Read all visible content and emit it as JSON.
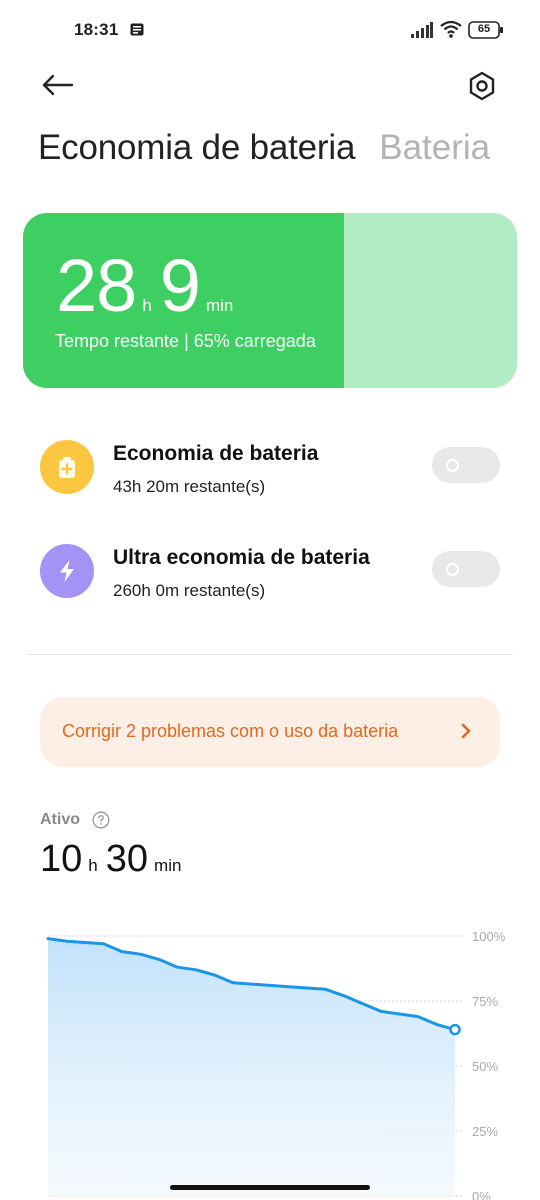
{
  "status_bar": {
    "time": "18:31",
    "battery_level": "65",
    "icons": [
      "notification-icon",
      "signal-icon",
      "wifi-icon",
      "battery-icon"
    ]
  },
  "header": {
    "icons": [
      "back-arrow-icon",
      "settings-hexagon-icon"
    ]
  },
  "tabs": {
    "active": "Economia de bateria",
    "inactive": "Bateria"
  },
  "battery_card": {
    "hours": "28",
    "hours_unit": "h",
    "minutes": "9",
    "minutes_unit": "min",
    "subtitle": "Tempo restante | 65% carregada",
    "charge_fraction": 0.65,
    "fill_color": "#3ecf62",
    "track_color": "#b2ecc5"
  },
  "modes": [
    {
      "title": "Economia de bateria",
      "subtitle": "43h 20m restante(s)",
      "icon": "battery-plus-icon",
      "icon_color": "#fcc641",
      "enabled": false
    },
    {
      "title": "Ultra economia de bateria",
      "subtitle": "260h 0m restante(s)",
      "icon": "lightning-icon",
      "icon_color": "#a592f7",
      "enabled": false
    }
  ],
  "fix_banner": {
    "text": "Corrigir 2 problemas com o uso da bateria",
    "text_color": "#e06a1f",
    "background": "#fdeee6"
  },
  "active": {
    "label": "Ativo",
    "hours": "10",
    "hours_unit": "h",
    "minutes": "30",
    "minutes_unit": "min"
  },
  "chart_data": {
    "type": "area",
    "y_ticks": [
      "100%",
      "75%",
      "50%",
      "25%",
      "0%"
    ],
    "ylim": [
      0,
      100
    ],
    "x": [
      0,
      1,
      2,
      3,
      4,
      5,
      6,
      7,
      8,
      9,
      10,
      11,
      12,
      13,
      14,
      15,
      16,
      17,
      18,
      19,
      20,
      21,
      22
    ],
    "values": [
      99,
      98,
      97.5,
      97,
      94,
      93,
      91,
      88,
      87,
      85,
      82,
      81.5,
      81,
      80.5,
      80,
      79.5,
      77,
      74,
      71,
      70,
      69,
      66,
      64
    ],
    "line_color": "#1a96e6",
    "fill_color": "#cde8fb",
    "grid": true
  }
}
